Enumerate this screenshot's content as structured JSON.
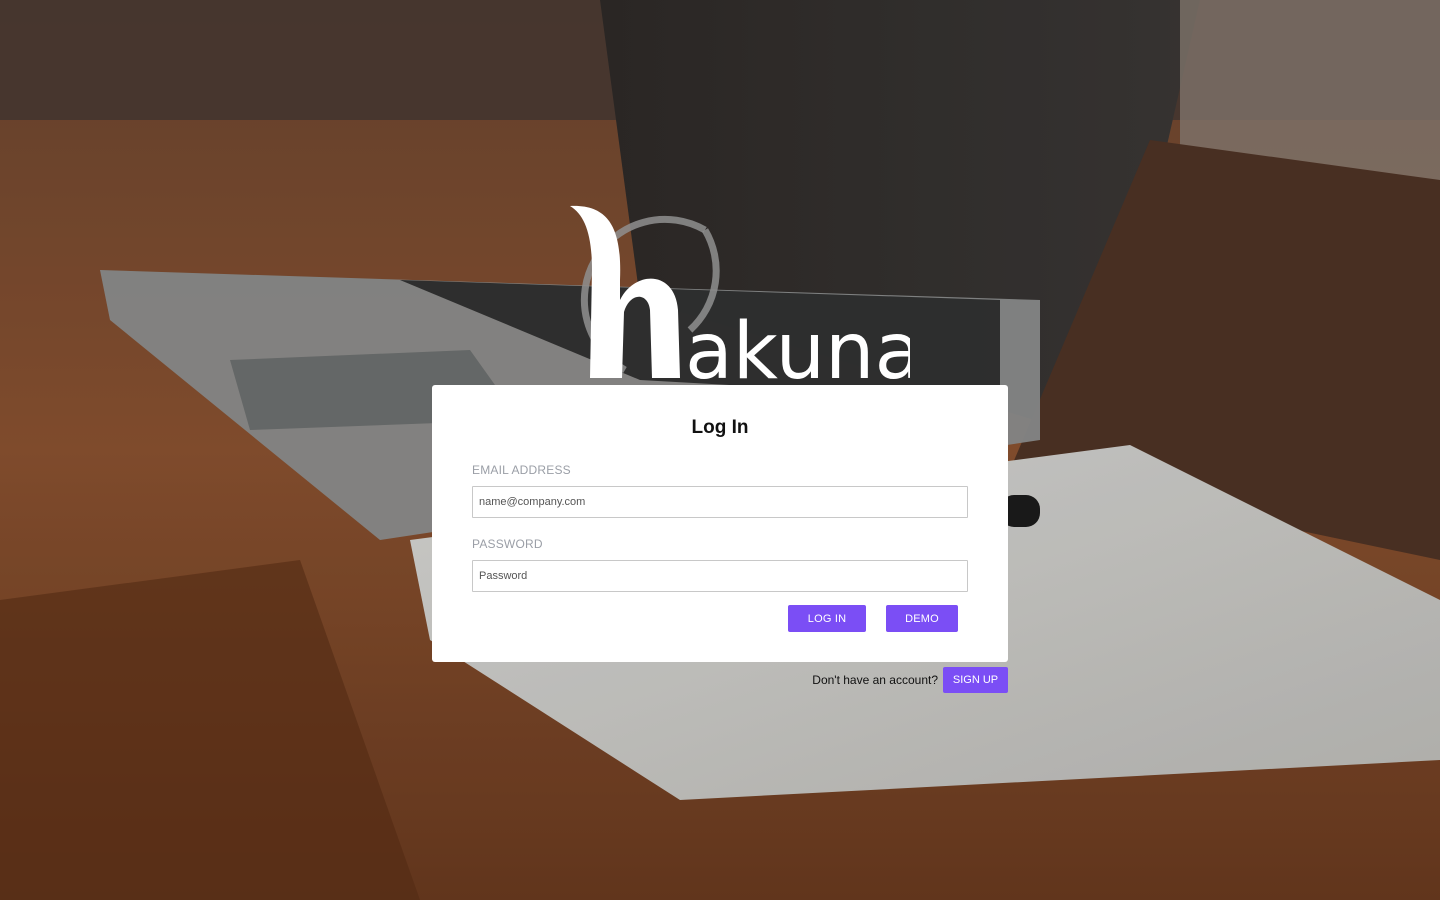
{
  "brand": {
    "logo_text": "akuna",
    "logo_initial": "h"
  },
  "login_card": {
    "title": "Log In",
    "email": {
      "label": "EMAIL ADDRESS",
      "placeholder": "name@company.com",
      "value": ""
    },
    "password": {
      "label": "PASSWORD",
      "placeholder": "Password",
      "value": ""
    },
    "login_button_label": "LOG IN",
    "demo_button_label": "DEMO"
  },
  "signup": {
    "prompt_text": "Don't have an account?",
    "button_label": "SIGN UP"
  },
  "colors": {
    "accent": "#7b4ef5",
    "card_background": "#ffffff",
    "label_gray": "#9a9ea6"
  }
}
